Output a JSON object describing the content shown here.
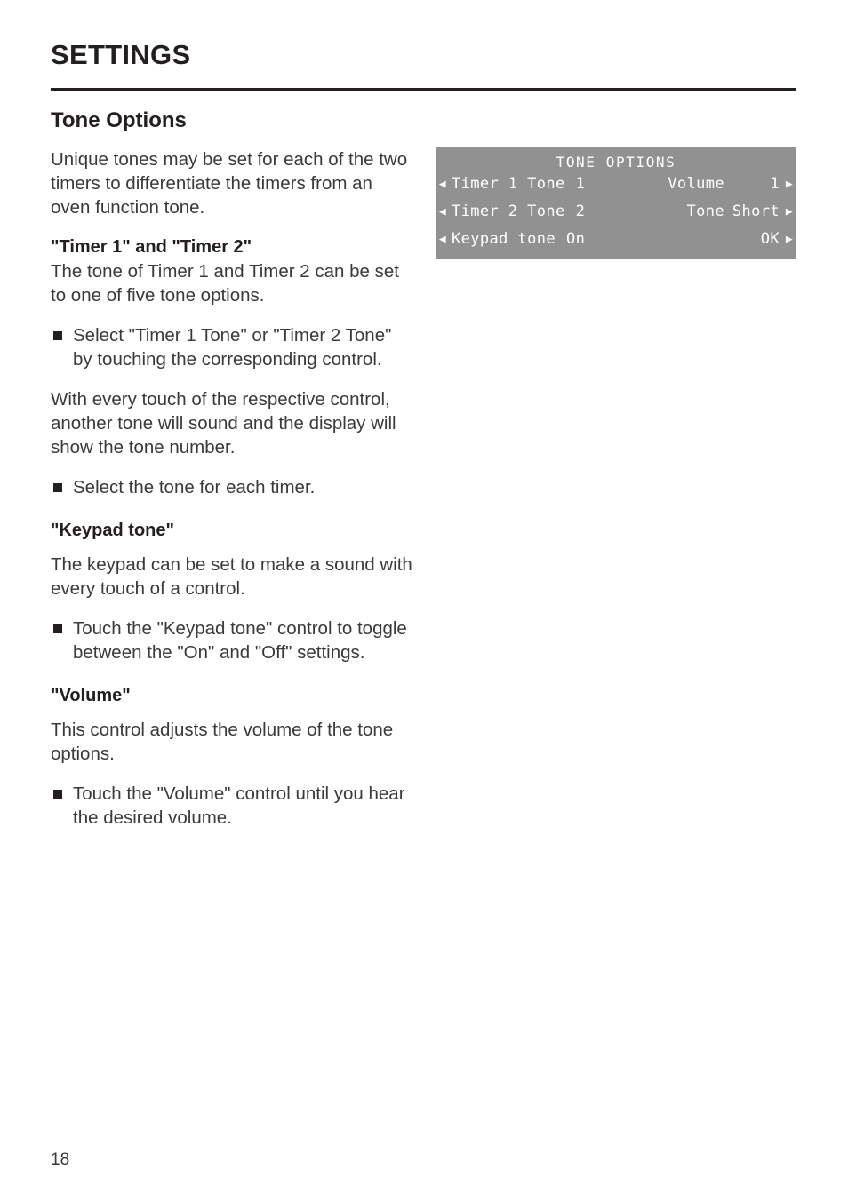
{
  "header": {
    "title": "SETTINGS"
  },
  "section": {
    "title": "Tone Options",
    "intro": "Unique tones may be set for each of the two timers to differentiate the timers from an oven function tone."
  },
  "timer_section": {
    "heading": "\"Timer 1\" and \"Timer 2\"",
    "body": "The tone of Timer 1 and Timer 2 can be set to one of five tone options.",
    "bullet_1": "Select \"Timer 1 Tone\" or \"Timer 2 Tone\" by touching the corresponding control.",
    "para_after": "With every touch of the respective control, another tone will sound and the display will show the tone number.",
    "bullet_2": "Select the tone for each timer."
  },
  "keypad_section": {
    "heading": "\"Keypad tone\"",
    "body": "The keypad can be set to make a sound with every touch of a control.",
    "bullet_1": "Touch the \"Keypad tone\" control to toggle between the \"On\" and \"Off\" settings."
  },
  "volume_section": {
    "heading": "\"Volume\"",
    "body": "This control adjusts the volume of the tone options.",
    "bullet_1": "Touch the \"Volume\" control until you hear the desired volume."
  },
  "lcd": {
    "title": "TONE OPTIONS",
    "background_color": "#919191",
    "text_color": "#FFFFFF",
    "arrow_left": "◀",
    "arrow_right": "▶",
    "rows": [
      {
        "left_label": "Timer 1 Tone",
        "left_value": "1",
        "right_label": "Volume",
        "right_value": "1"
      },
      {
        "left_label": "Timer 2 Tone",
        "left_value": "2",
        "right_label": "Tone",
        "right_value": "Short"
      },
      {
        "left_label": "Keypad tone",
        "left_value": "On",
        "right_label": "",
        "right_value": "OK"
      }
    ]
  },
  "footer": {
    "page_number": "18"
  }
}
